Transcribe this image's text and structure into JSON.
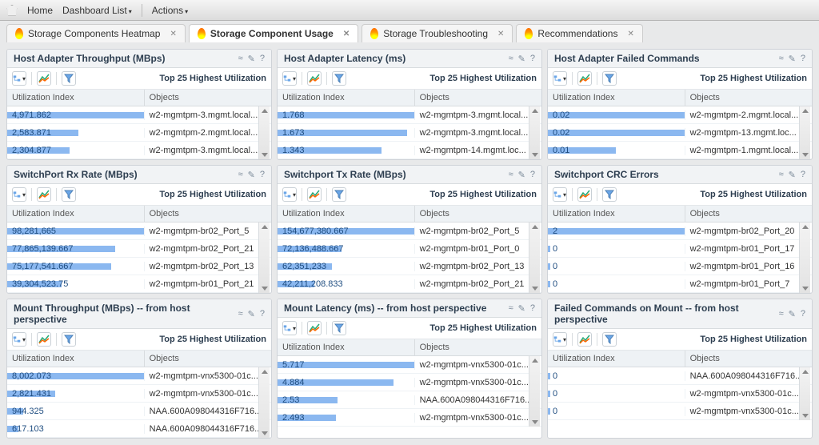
{
  "topbar": {
    "home": "Home",
    "dashboard_list": "Dashboard List",
    "actions": "Actions"
  },
  "tabs": [
    {
      "label": "Storage Components Heatmap"
    },
    {
      "label": "Storage Component Usage",
      "active": true
    },
    {
      "label": "Storage Troubleshooting"
    },
    {
      "label": "Recommendations"
    }
  ],
  "shared": {
    "top_label": "Top 25 Highest Utilization",
    "col_index": "Utilization Index",
    "col_objects": "Objects",
    "collapse": "≈",
    "edit_icon": "✎",
    "help": "?",
    "dropdown": "▾"
  },
  "panels": [
    {
      "title": "Host Adapter Throughput (MBps)",
      "rows": [
        {
          "idx": "4,971.862",
          "pct": 100,
          "obj": "w2-mgmtpm-3.mgmt.local..."
        },
        {
          "idx": "2,583.871",
          "pct": 52,
          "obj": "w2-mgmtpm-2.mgmt.local..."
        },
        {
          "idx": "2,304.877",
          "pct": 46,
          "obj": "w2-mgmtpm-3.mgmt.local..."
        }
      ]
    },
    {
      "title": "Host Adapter Latency (ms)",
      "rows": [
        {
          "idx": "1.768",
          "pct": 100,
          "obj": "w2-mgmtpm-3.mgmt.local..."
        },
        {
          "idx": "1.673",
          "pct": 95,
          "obj": "w2-mgmtpm-3.mgmt.local..."
        },
        {
          "idx": "1.343",
          "pct": 76,
          "obj": "w2-mgmtpm-14.mgmt.loc..."
        }
      ]
    },
    {
      "title": "Host Adapter Failed Commands",
      "rows": [
        {
          "idx": "0.02",
          "pct": 100,
          "obj": "w2-mgmtpm-2.mgmt.local..."
        },
        {
          "idx": "0.02",
          "pct": 100,
          "obj": "w2-mgmtpm-13.mgmt.loc..."
        },
        {
          "idx": "0.01",
          "pct": 50,
          "obj": "w2-mgmtpm-1.mgmt.local..."
        }
      ]
    },
    {
      "title": "SwitchPort Rx Rate (MBps)",
      "rows": [
        {
          "idx": "98,281,665",
          "pct": 100,
          "obj": "w2-mgmtpm-br02_Port_5"
        },
        {
          "idx": "77,865,139.667",
          "pct": 79,
          "obj": "w2-mgmtpm-br02_Port_21"
        },
        {
          "idx": "75,177,541.667",
          "pct": 76,
          "obj": "w2-mgmtpm-br02_Port_13"
        },
        {
          "idx": "39,304,523.75",
          "pct": 40,
          "obj": "w2-mgmtpm-br01_Port_21"
        }
      ]
    },
    {
      "title": "Switchport Tx Rate (MBps)",
      "rows": [
        {
          "idx": "154,677,380.667",
          "pct": 100,
          "obj": "w2-mgmtpm-br02_Port_5"
        },
        {
          "idx": "72,136,488.667",
          "pct": 47,
          "obj": "w2-mgmtpm-br01_Port_0"
        },
        {
          "idx": "62,351,233",
          "pct": 40,
          "obj": "w2-mgmtpm-br02_Port_13"
        },
        {
          "idx": "42,211,208.833",
          "pct": 27,
          "obj": "w2-mgmtpm-br02_Port_21"
        }
      ]
    },
    {
      "title": "Switchport CRC Errors",
      "rows": [
        {
          "idx": "2",
          "pct": 100,
          "obj": "w2-mgmtpm-br02_Port_20"
        },
        {
          "idx": "0",
          "pct": 2,
          "obj": "w2-mgmtpm-br01_Port_17"
        },
        {
          "idx": "0",
          "pct": 2,
          "obj": "w2-mgmtpm-br01_Port_16"
        },
        {
          "idx": "0",
          "pct": 2,
          "obj": "w2-mgmtpm-br01_Port_7"
        }
      ]
    },
    {
      "title": "Mount Throughput (MBps) -- from host perspective",
      "rows": [
        {
          "idx": "8,002.073",
          "pct": 100,
          "obj": "w2-mgmtpm-vnx5300-01c..."
        },
        {
          "idx": "2,821.431",
          "pct": 35,
          "obj": "w2-mgmtpm-vnx5300-01c..."
        },
        {
          "idx": "944.325",
          "pct": 12,
          "obj": "NAA.600A098044316F716..."
        },
        {
          "idx": "617.103",
          "pct": 8,
          "obj": "NAA.600A098044316F716..."
        }
      ]
    },
    {
      "title": "Mount Latency (ms) -- from host perspective",
      "rows": [
        {
          "idx": "5.717",
          "pct": 100,
          "obj": "w2-mgmtpm-vnx5300-01c..."
        },
        {
          "idx": "4.884",
          "pct": 85,
          "obj": "w2-mgmtpm-vnx5300-01c..."
        },
        {
          "idx": "2.53",
          "pct": 44,
          "obj": "NAA.600A098044316F716..."
        },
        {
          "idx": "2.493",
          "pct": 43,
          "obj": "w2-mgmtpm-vnx5300-01c..."
        }
      ]
    },
    {
      "title": "Failed Commands on Mount -- from host perspective",
      "rows": [
        {
          "idx": "0",
          "pct": 2,
          "obj": "NAA.600A098044316F716..."
        },
        {
          "idx": "0",
          "pct": 2,
          "obj": "w2-mgmtpm-vnx5300-01c..."
        },
        {
          "idx": "0",
          "pct": 2,
          "obj": "w2-mgmtpm-vnx5300-01c..."
        }
      ]
    }
  ]
}
